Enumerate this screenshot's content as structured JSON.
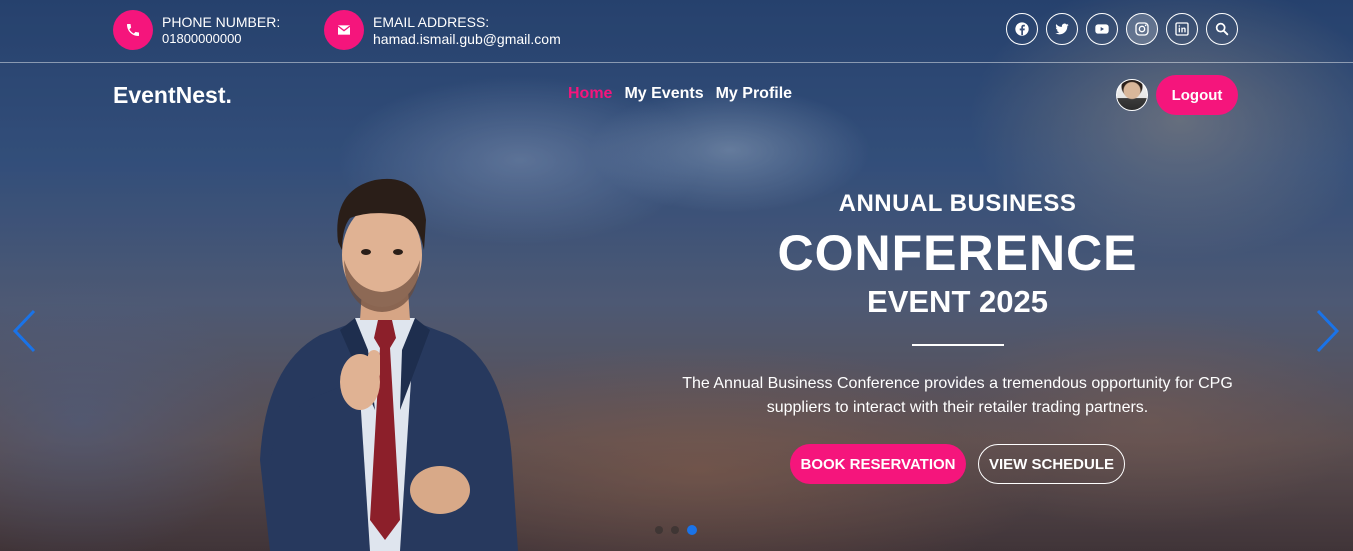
{
  "topbar": {
    "phone": {
      "label": "PHONE NUMBER:",
      "value": "01800000000",
      "icon": "phone-icon"
    },
    "email": {
      "label": "EMAIL ADDRESS:",
      "value": "hamad.ismail.gub@gmail.com",
      "icon": "mail-icon"
    },
    "social": [
      "facebook-icon",
      "twitter-icon",
      "youtube-icon",
      "instagram-icon",
      "linkedin-icon",
      "search-icon"
    ]
  },
  "nav": {
    "logo": "EventNest.",
    "links": [
      {
        "label": "Home",
        "active": true
      },
      {
        "label": "My Events",
        "active": false
      },
      {
        "label": "My Profile",
        "active": false
      }
    ],
    "logout": "Logout"
  },
  "hero": {
    "subtitle": "ANNUAL BUSINESS",
    "title": "CONFERENCE",
    "year_line": "EVENT 2025",
    "description": "The Annual Business Conference provides a tremendous opportunity for CPG suppliers to interact with their retailer trading partners.",
    "primary_button": "BOOK RESERVATION",
    "secondary_button": "VIEW SCHEDULE"
  },
  "slider": {
    "total": 3,
    "active_index": 3
  },
  "colors": {
    "accent": "#f5157c",
    "arrow": "#1a73e8"
  }
}
